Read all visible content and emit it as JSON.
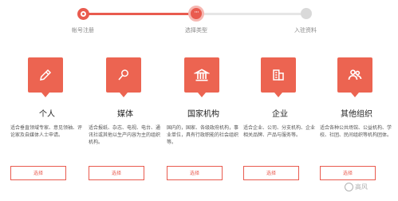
{
  "stepper": {
    "steps": [
      {
        "label": "帐号注册",
        "state": "done"
      },
      {
        "label": "选择类型",
        "state": "current",
        "marker": "···"
      },
      {
        "label": "入驻资料",
        "state": "todo"
      }
    ]
  },
  "cards": [
    {
      "icon": "pencil-icon",
      "title": "个人",
      "description": "适合垂直领域专家、意见领袖、评论家及自媒体人士申请。",
      "button": "选择"
    },
    {
      "icon": "microphone-icon",
      "title": "媒体",
      "description": "适合报纸、杂志、电视、电台、通讯社或其他以生产内容为主的组织机构。",
      "button": "选择"
    },
    {
      "icon": "institution-icon",
      "title": "国家机构",
      "description": "国内的，国家、各级政府机构，事业单位，具有行政职能的社会组织等。",
      "button": "选择"
    },
    {
      "icon": "building-icon",
      "title": "企业",
      "description": "适合企业、公司、分支机构、企业相关品牌、产品与服务等。",
      "button": "选择"
    },
    {
      "icon": "group-icon",
      "title": "其他组织",
      "description": "适合各种公共场馆、公益机构、学校、社团、民间组织等机构团体。",
      "button": "选择"
    }
  ],
  "watermark": {
    "text": "高风"
  },
  "colors": {
    "accent": "#e95b4f",
    "icon_bg": "#ec6451",
    "inactive": "#e6e6e6"
  }
}
